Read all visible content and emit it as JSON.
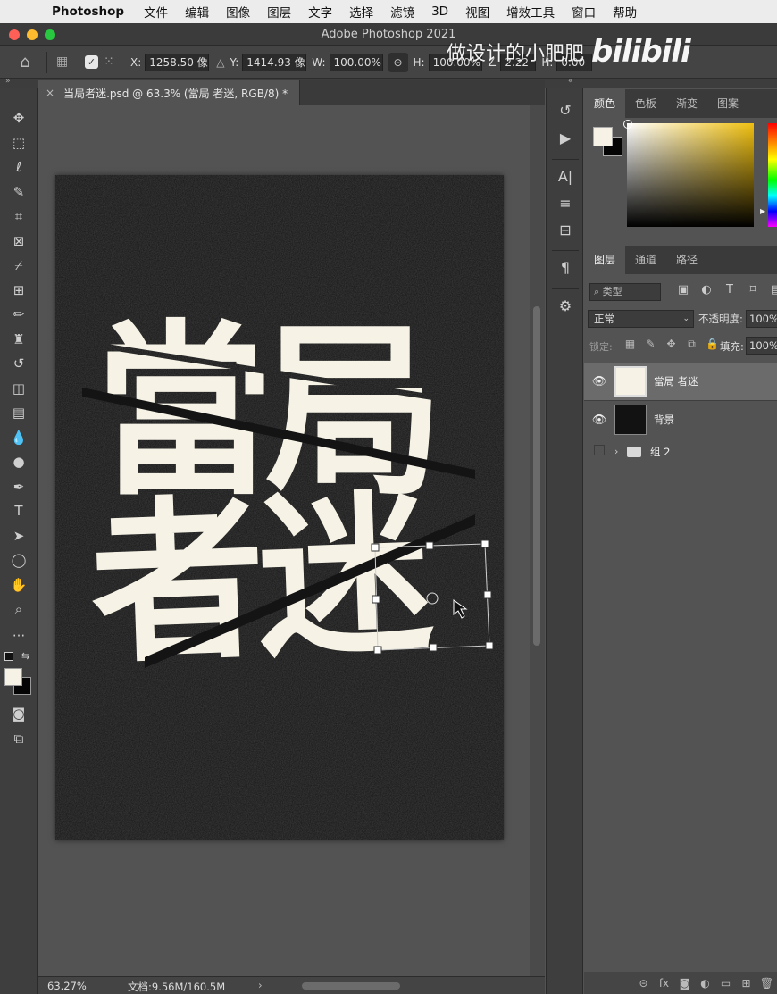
{
  "menubar": {
    "app": "Photoshop",
    "items": [
      "文件",
      "编辑",
      "图像",
      "图层",
      "文字",
      "选择",
      "滤镜",
      "3D",
      "视图",
      "增效工具",
      "窗口",
      "帮助"
    ]
  },
  "window": {
    "title": "Adobe Photoshop 2021"
  },
  "watermark": {
    "text": "做设计的小肥肥"
  },
  "options": {
    "x_label": "X:",
    "x_value": "1258.50 像",
    "y_label": "Y:",
    "y_value": "1414.93 像",
    "w_label": "W:",
    "w_value": "100.00%",
    "h_label": "H:",
    "h_value": "100.00%",
    "angle_value": "2.22",
    "hskew_label": "H:",
    "hskew_value": "0.00"
  },
  "document": {
    "tab_title": "当局者迷.psd @ 63.3% (當局 者迷, RGB/8) *",
    "artwork_line1": "當局",
    "artwork_line2": "者迷",
    "background_color": "#141414",
    "text_color": "#f6f3e6"
  },
  "status": {
    "zoom": "63.27%",
    "doc_info": "文档:9.56M/160.5M"
  },
  "color_panel": {
    "tabs": [
      "颜色",
      "色板",
      "渐变",
      "图案"
    ],
    "foreground": "#f6f3e6",
    "background": "#050505"
  },
  "layers_panel": {
    "tabs": [
      "图层",
      "通道",
      "路径"
    ],
    "filter_label": "类型",
    "blend_mode": "正常",
    "opacity_label": "不透明度:",
    "opacity_value": "100%",
    "lock_label": "锁定:",
    "fill_label": "填充:",
    "fill_value": "100%",
    "layers": [
      {
        "name": "當局 者迷",
        "visible": true,
        "selected": true
      },
      {
        "name": "背景",
        "visible": true,
        "selected": false
      },
      {
        "name": "组 2",
        "visible": false,
        "selected": false,
        "type": "group"
      }
    ]
  }
}
